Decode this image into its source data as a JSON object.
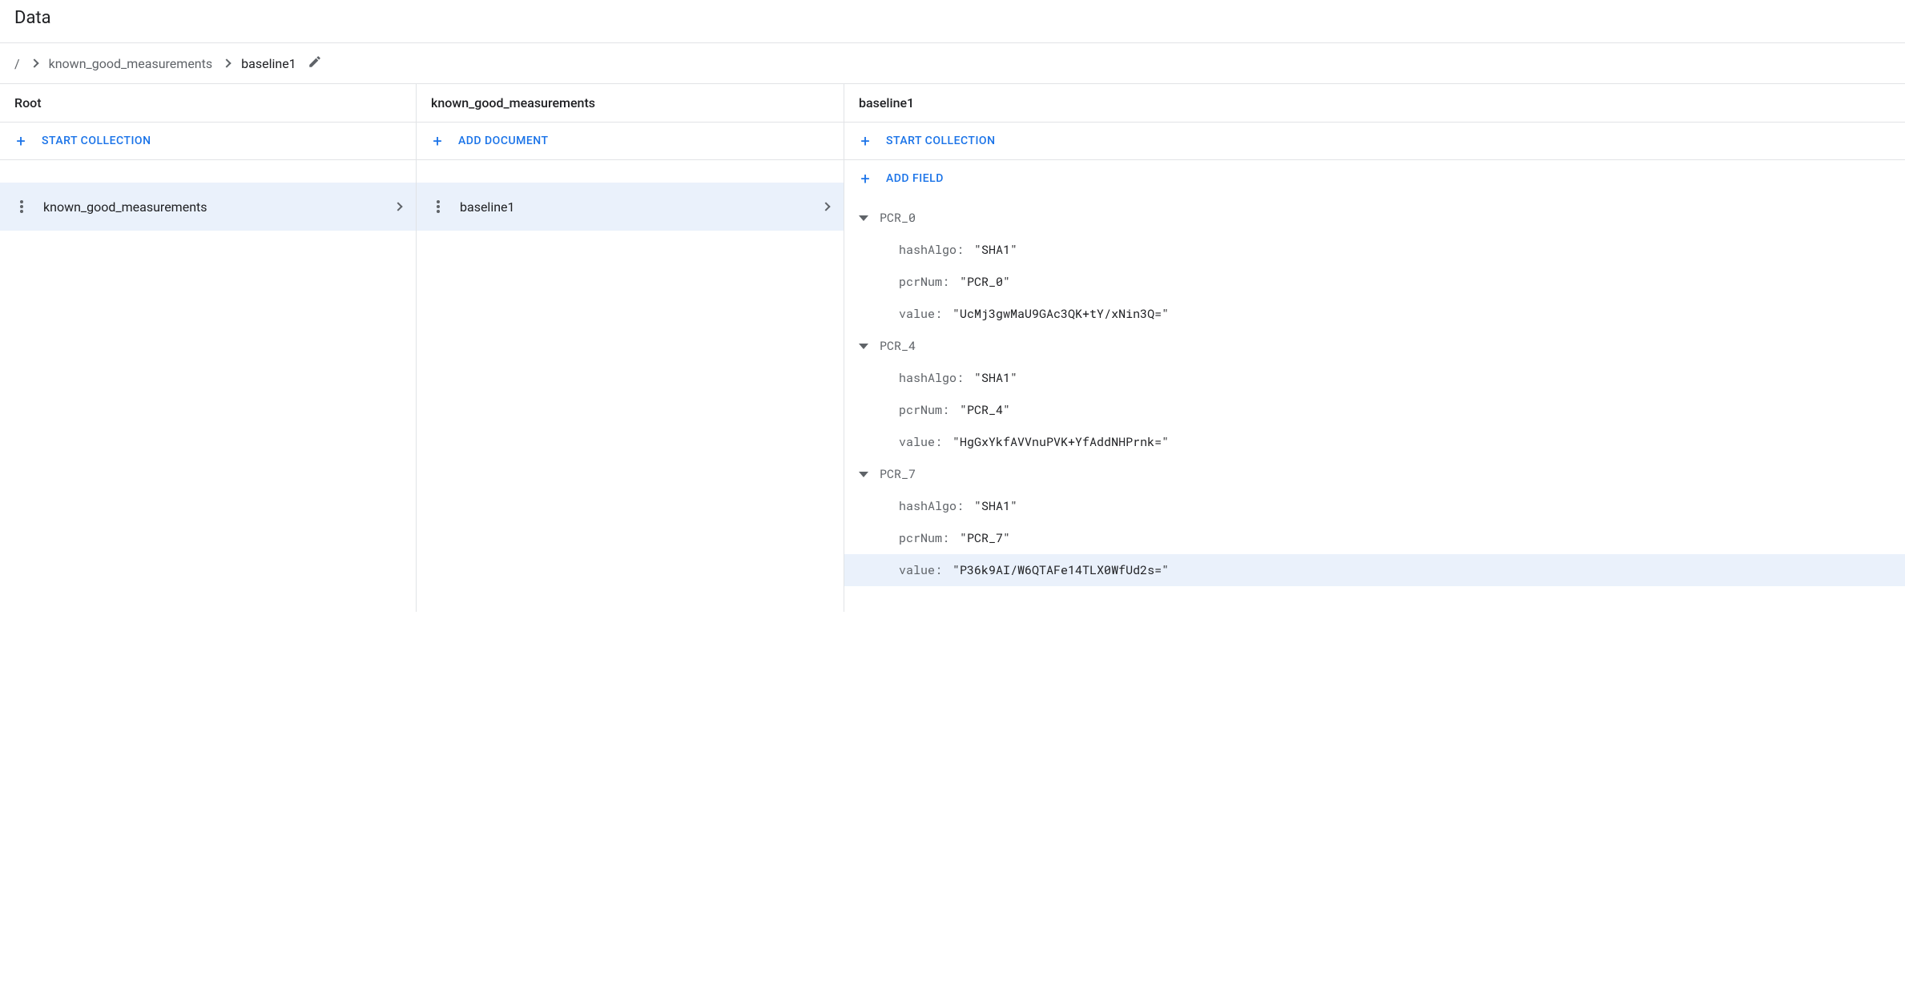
{
  "title": "Data",
  "breadcrumb": {
    "root": "/",
    "collection": "known_good_measurements",
    "document": "baseline1"
  },
  "panel1": {
    "header": "Root",
    "action": "START COLLECTION",
    "items": [
      "known_good_measurements"
    ]
  },
  "panel2": {
    "header": "known_good_measurements",
    "action": "ADD DOCUMENT",
    "items": [
      "baseline1"
    ]
  },
  "panel3": {
    "header": "baseline1",
    "action1": "START COLLECTION",
    "action2": "ADD FIELD",
    "fields": [
      {
        "name": "PCR_0",
        "children": [
          {
            "key": "hashAlgo",
            "value": "\"SHA1\""
          },
          {
            "key": "pcrNum",
            "value": "\"PCR_0\""
          },
          {
            "key": "value",
            "value": "\"UcMj3gwMaU9GAc3QK+tY/xNin3Q=\""
          }
        ]
      },
      {
        "name": "PCR_4",
        "children": [
          {
            "key": "hashAlgo",
            "value": "\"SHA1\""
          },
          {
            "key": "pcrNum",
            "value": "\"PCR_4\""
          },
          {
            "key": "value",
            "value": "\"HgGxYkfAVVnuPVK+YfAddNHPrnk=\""
          }
        ]
      },
      {
        "name": "PCR_7",
        "children": [
          {
            "key": "hashAlgo",
            "value": "\"SHA1\""
          },
          {
            "key": "pcrNum",
            "value": "\"PCR_7\""
          },
          {
            "key": "value",
            "value": "\"P36k9AI/W6QTAFe14TLX0WfUd2s=\"",
            "hover": true
          }
        ]
      }
    ]
  }
}
